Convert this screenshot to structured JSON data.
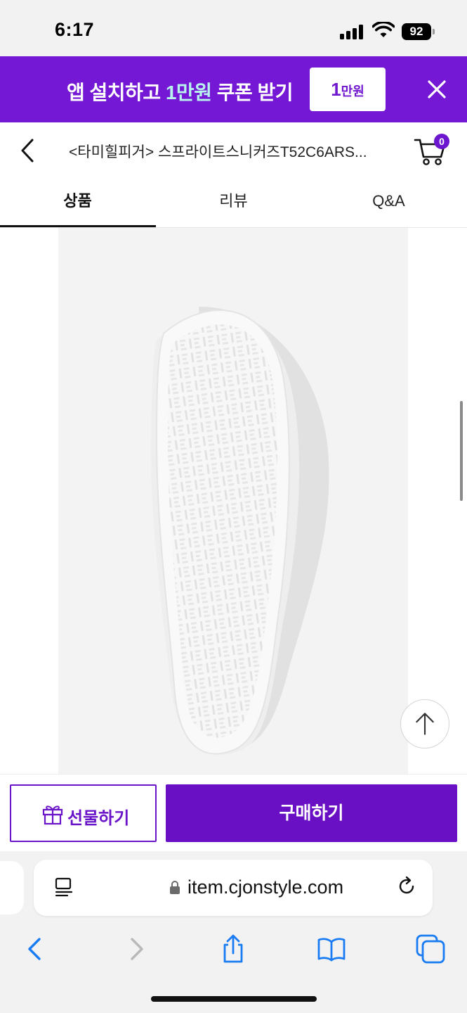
{
  "status": {
    "time": "6:17",
    "battery": "92"
  },
  "promo": {
    "text_part1": "앱 설치하고 ",
    "text_highlight": "1만원",
    "text_part2": " 쿠폰 받기",
    "badge_big": "1",
    "badge_small": "만원",
    "accent_color": "#7518d6"
  },
  "header": {
    "title": "<타미힐피거> 스프라이트스니커즈T52C6ARS...",
    "cart_count": "0"
  },
  "tabs": [
    {
      "label": "상품",
      "active": true
    },
    {
      "label": "리뷰",
      "active": false
    },
    {
      "label": "Q&A",
      "active": false
    }
  ],
  "actions": {
    "gift_label": "선물하기",
    "buy_label": "구매하기",
    "brand_color": "#6a10c4"
  },
  "browser": {
    "url": "item.cjonstyle.com"
  },
  "icons": {
    "back": "chevron-left-icon",
    "cart": "cart-icon",
    "close": "close-icon",
    "top": "arrow-up-icon",
    "gift": "gift-icon",
    "reader": "reader-icon",
    "lock": "lock-icon",
    "reload": "reload-icon",
    "share": "share-icon",
    "bookmarks": "book-icon",
    "tabs": "tabs-icon"
  }
}
